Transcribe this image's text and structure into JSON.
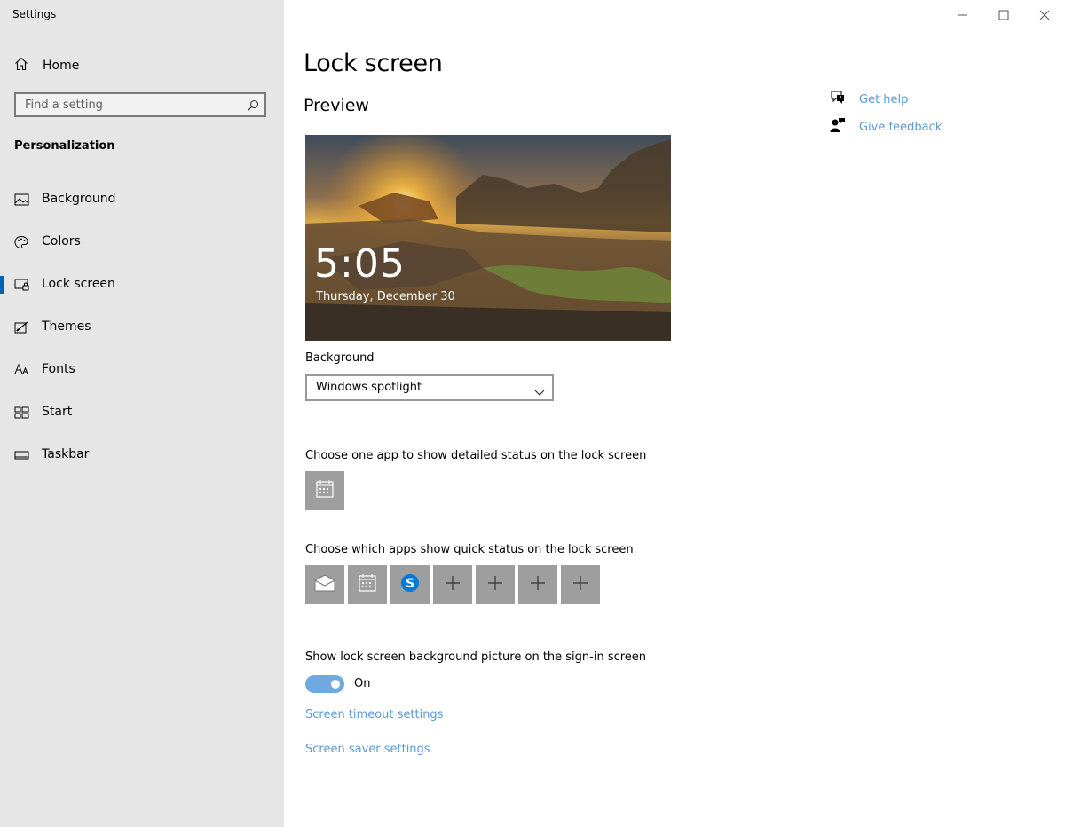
{
  "window": {
    "title": "Settings",
    "controls": [
      "minimize",
      "maximize",
      "close"
    ]
  },
  "sidebar": {
    "home_label": "Home",
    "search_placeholder": "Find a setting",
    "section_title": "Personalization",
    "items": [
      {
        "label": "Background",
        "icon": "image-icon"
      },
      {
        "label": "Colors",
        "icon": "palette-icon"
      },
      {
        "label": "Lock screen",
        "icon": "lock-screen-icon",
        "active": true
      },
      {
        "label": "Themes",
        "icon": "themes-icon"
      },
      {
        "label": "Fonts",
        "icon": "fonts-icon"
      },
      {
        "label": "Start",
        "icon": "start-icon"
      },
      {
        "label": "Taskbar",
        "icon": "taskbar-icon"
      }
    ]
  },
  "main": {
    "title": "Lock screen",
    "preview_title": "Preview",
    "preview_time": "5:05",
    "preview_date": "Thursday, December 30",
    "background_label": "Background",
    "background_value": "Windows spotlight",
    "detailed_status_label": "Choose one app to show detailed status on the lock screen",
    "detailed_status_app": "calendar-icon",
    "quick_status_label": "Choose which apps show quick status on the lock screen",
    "quick_status_apps": [
      "mail-icon",
      "calendar-icon",
      "skype-icon",
      "plus-icon",
      "plus-icon",
      "plus-icon",
      "plus-icon"
    ],
    "signin_label": "Show lock screen background picture on the sign-in screen",
    "signin_toggle_state": "On",
    "signin_toggle_on": true,
    "timeout_link": "Screen timeout settings",
    "screensaver_link": "Screen saver settings"
  },
  "help": {
    "get_help": "Get help",
    "give_feedback": "Give feedback"
  },
  "colors": {
    "sidebar_bg": "#e6e6e6",
    "accent": "#0063b1",
    "link": "#5b9bd5",
    "toggle_on": "#6fa9e0",
    "tile_bg": "#9e9e9e"
  }
}
